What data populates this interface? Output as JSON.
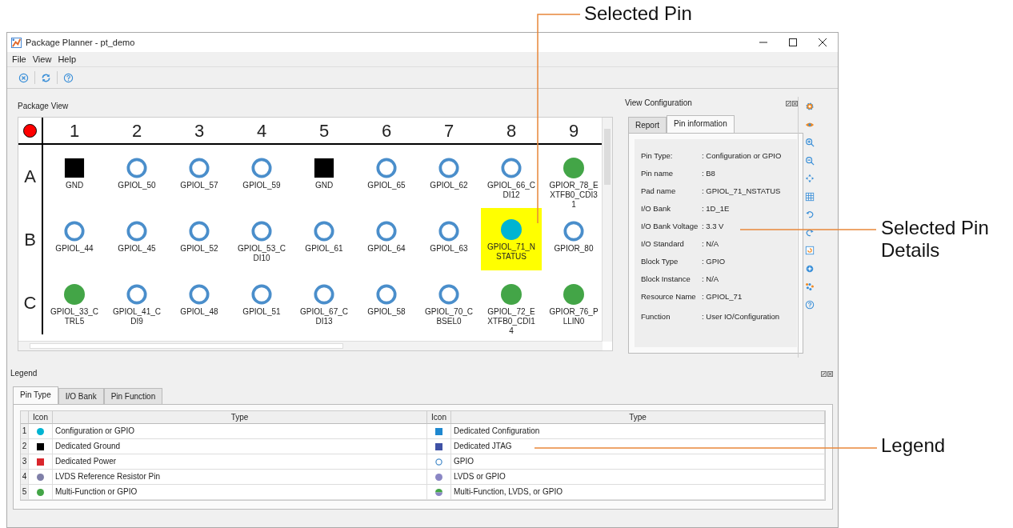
{
  "window": {
    "title": "Package Planner - pt_demo"
  },
  "menu": [
    {
      "label": "File"
    },
    {
      "label": "View"
    },
    {
      "label": "Help"
    }
  ],
  "package_view": {
    "title": "Package View",
    "columns": [
      "1",
      "2",
      "3",
      "4",
      "5",
      "6",
      "7",
      "8",
      "9"
    ],
    "rows": [
      {
        "label": "A",
        "pins": [
          {
            "label": "GND",
            "kind": "ground",
            "selected": false
          },
          {
            "label": "GPIOL_50",
            "kind": "gpio",
            "selected": false
          },
          {
            "label": "GPIOL_57",
            "kind": "gpio",
            "selected": false
          },
          {
            "label": "GPIOL_59",
            "kind": "gpio",
            "selected": false
          },
          {
            "label": "GND",
            "kind": "ground",
            "selected": false
          },
          {
            "label": "GPIOL_65",
            "kind": "gpio",
            "selected": false
          },
          {
            "label": "GPIOL_62",
            "kind": "gpio",
            "selected": false
          },
          {
            "label": "GPIOL_66_CDI12",
            "kind": "gpio",
            "selected": false
          },
          {
            "label": "GPIOR_78_EXTFB0_CDI31",
            "kind": "multi",
            "selected": false
          }
        ]
      },
      {
        "label": "B",
        "pins": [
          {
            "label": "GPIOL_44",
            "kind": "gpio",
            "selected": false
          },
          {
            "label": "GPIOL_45",
            "kind": "gpio",
            "selected": false
          },
          {
            "label": "GPIOL_52",
            "kind": "gpio",
            "selected": false
          },
          {
            "label": "GPIOL_53_CDI10",
            "kind": "gpio",
            "selected": false
          },
          {
            "label": "GPIOL_61",
            "kind": "gpio",
            "selected": false
          },
          {
            "label": "GPIOL_64",
            "kind": "gpio",
            "selected": false
          },
          {
            "label": "GPIOL_63",
            "kind": "gpio",
            "selected": false
          },
          {
            "label": "GPIOL_71_NSTATUS",
            "kind": "config",
            "selected": true
          },
          {
            "label": "GPIOR_80",
            "kind": "gpio",
            "selected": false
          }
        ]
      },
      {
        "label": "C",
        "pins": [
          {
            "label": "GPIOL_33_CTRL5",
            "kind": "multi",
            "selected": false
          },
          {
            "label": "GPIOL_41_CDI9",
            "kind": "gpio",
            "selected": false
          },
          {
            "label": "GPIOL_48",
            "kind": "gpio",
            "selected": false
          },
          {
            "label": "GPIOL_51",
            "kind": "gpio",
            "selected": false
          },
          {
            "label": "GPIOL_67_CDI13",
            "kind": "gpio",
            "selected": false
          },
          {
            "label": "GPIOL_58",
            "kind": "gpio",
            "selected": false
          },
          {
            "label": "GPIOL_70_CBSEL0",
            "kind": "gpio",
            "selected": false
          },
          {
            "label": "GPIOL_72_EXTFB0_CDI14",
            "kind": "multi",
            "selected": false
          },
          {
            "label": "GPIOR_76_PLLIN0",
            "kind": "multi",
            "selected": false
          }
        ]
      }
    ]
  },
  "view_configuration": {
    "title": "View Configuration",
    "tabs": [
      {
        "label": "Report",
        "selected": false
      },
      {
        "label": "Pin information",
        "selected": true
      }
    ],
    "fields": [
      {
        "label": "Pin Type:",
        "value": ": Configuration or GPIO"
      },
      {
        "label": "Pin name",
        "value": ": B8"
      },
      {
        "label": "Pad name",
        "value": ": GPIOL_71_NSTATUS"
      },
      {
        "label": "I/O Bank",
        "value": ": 1D_1E"
      },
      {
        "label": "I/O Bank Voltage",
        "value": ": 3.3 V"
      },
      {
        "label": "I/O Standard",
        "value": ": N/A"
      },
      {
        "label": "Block Type",
        "value": ": GPIO"
      },
      {
        "label": "Block Instance",
        "value": ": N/A"
      },
      {
        "label": "Resource Name",
        "value": ": GPIOL_71"
      },
      {
        "label": "Function",
        "value": ": User IO/Configuration"
      }
    ]
  },
  "legend": {
    "title": "Legend",
    "tabs": [
      {
        "label": "Pin Type",
        "selected": true
      },
      {
        "label": "I/O Bank",
        "selected": false
      },
      {
        "label": "Pin Function",
        "selected": false
      }
    ],
    "columns": [
      "Icon",
      "Type",
      "Icon",
      "Type"
    ],
    "rows": [
      {
        "number": "1",
        "left": {
          "kind": "config",
          "type": "Configuration or GPIO"
        },
        "right": {
          "kind": "ded_config",
          "type": "Dedicated Configuration"
        }
      },
      {
        "number": "2",
        "left": {
          "kind": "ground",
          "type": "Dedicated Ground"
        },
        "right": {
          "kind": "jtag",
          "type": "Dedicated JTAG"
        }
      },
      {
        "number": "3",
        "left": {
          "kind": "power",
          "type": "Dedicated Power"
        },
        "right": {
          "kind": "gpio",
          "type": "GPIO"
        }
      },
      {
        "number": "4",
        "left": {
          "kind": "lvds_ref",
          "type": "LVDS Reference Resistor Pin"
        },
        "right": {
          "kind": "lvds",
          "type": "LVDS or GPIO"
        }
      },
      {
        "number": "5",
        "left": {
          "kind": "multi",
          "type": "Multi-Function or GPIO"
        },
        "right": {
          "kind": "multi_lvds",
          "type": "Multi-Function, LVDS, or GPIO"
        }
      }
    ]
  },
  "callouts": [
    {
      "text": "Selected Pin"
    },
    {
      "text": "Selected Pin Details"
    },
    {
      "text": "Legend"
    }
  ]
}
